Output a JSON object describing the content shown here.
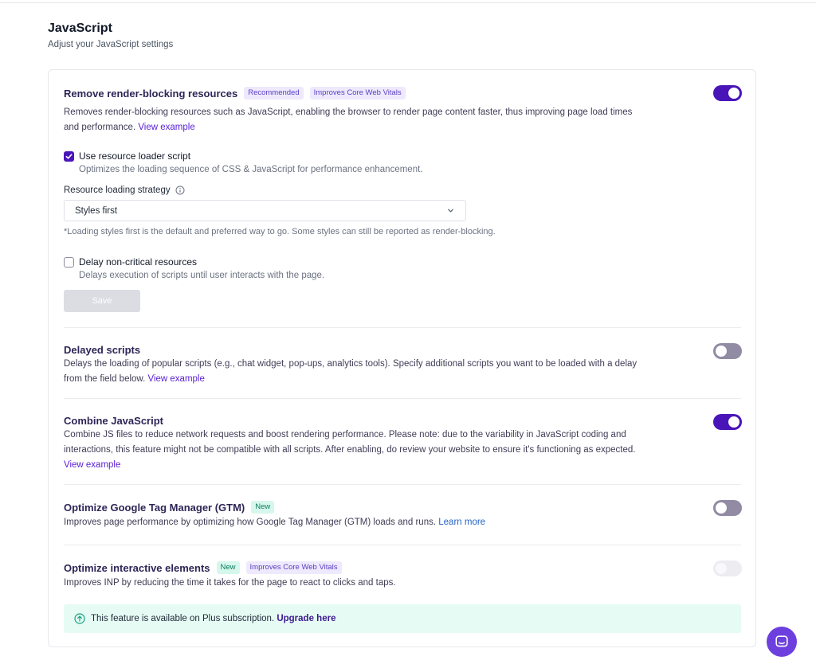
{
  "header": {
    "title": "JavaScript",
    "subtitle": "Adjust your JavaScript settings"
  },
  "sections": {
    "render_blocking": {
      "title": "Remove render-blocking resources",
      "badges": [
        "Recommended",
        "Improves Core Web Vitals"
      ],
      "description": "Removes render-blocking resources such as JavaScript, enabling the browser to render page content faster, thus improving page load times and performance.",
      "link": "View example",
      "enabled": true,
      "loader_script": {
        "label": "Use resource loader script",
        "description": "Optimizes the loading sequence of CSS & JavaScript for performance enhancement.",
        "checked": true
      },
      "strategy": {
        "label": "Resource loading strategy",
        "value": "Styles first",
        "hint": "*Loading styles first is the default and preferred way to go. Some styles can still be reported as render-blocking."
      },
      "delay_noncritical": {
        "label": "Delay non-critical resources",
        "description": "Delays execution of scripts until user interacts with the page.",
        "checked": false
      },
      "save_label": "Save"
    },
    "delayed_scripts": {
      "title": "Delayed scripts",
      "description": "Delays the loading of popular scripts (e.g., chat widget, pop-ups, analytics tools). Specify additional scripts you want to be loaded with a delay from the field below.",
      "link": "View example",
      "enabled": false
    },
    "combine_js": {
      "title": "Combine JavaScript",
      "description": "Combine JS files to reduce network requests and boost rendering performance. Please note: due to the variability in JavaScript coding and interactions, this feature might not be compatible with all scripts. After enabling, do review your website to ensure it's functioning as expected.",
      "link": "View example",
      "enabled": true
    },
    "gtm": {
      "title": "Optimize Google Tag Manager (GTM)",
      "badges": [
        "New"
      ],
      "description": "Improves page performance by optimizing how Google Tag Manager (GTM) loads and runs.",
      "link": "Learn more",
      "enabled": false
    },
    "interactive": {
      "title": "Optimize interactive elements",
      "badges": [
        "New",
        "Improves Core Web Vitals"
      ],
      "description": "Improves INP by reducing the time it takes for the page to react to clicks and taps.",
      "enabled": false,
      "disabled": true
    }
  },
  "banner": {
    "text": "This feature is available on Plus subscription.",
    "link": "Upgrade here"
  },
  "icons": {
    "info": "info-icon",
    "chevron": "chevron-down-icon",
    "check": "check-icon",
    "upgrade": "arrow-up-circle-icon",
    "chat": "chat-icon"
  },
  "colors": {
    "accent": "#4a15b8",
    "link": "#5b21d6",
    "banner_bg": "#e6fbf4",
    "chat_bg": "#6d3fde"
  }
}
